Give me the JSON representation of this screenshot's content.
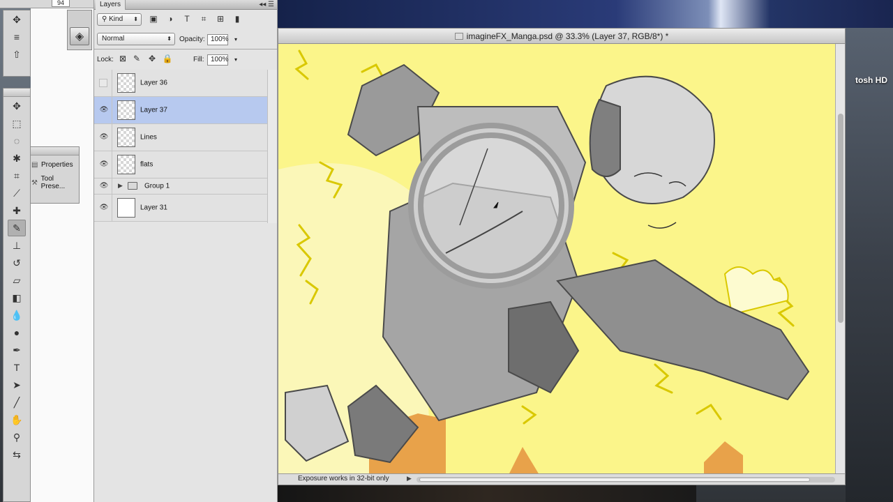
{
  "options_bar": {
    "size_value": "94"
  },
  "desktop": {
    "hd_label": "tosh HD"
  },
  "layers_panel": {
    "tab_label": "Layers",
    "filter_kind": "Kind",
    "blend_mode": "Normal",
    "opacity_label": "Opacity:",
    "opacity_value": "100%",
    "lock_label": "Lock:",
    "fill_label": "Fill:",
    "fill_value": "100%",
    "layers": [
      {
        "name": "Layer 36",
        "visible": false,
        "selected": false,
        "type": "layer"
      },
      {
        "name": "Layer 37",
        "visible": true,
        "selected": true,
        "type": "layer"
      },
      {
        "name": "Lines",
        "visible": true,
        "selected": false,
        "type": "layer"
      },
      {
        "name": "flats",
        "visible": true,
        "selected": false,
        "type": "layer"
      },
      {
        "name": "Group 1",
        "visible": true,
        "selected": false,
        "type": "group"
      },
      {
        "name": "Layer 31",
        "visible": true,
        "selected": false,
        "type": "layer-white"
      }
    ]
  },
  "float_panel": {
    "items": [
      {
        "label": "Properties",
        "icon": "properties-icon"
      },
      {
        "label": "Tool Prese...",
        "icon": "tool-presets-icon"
      }
    ]
  },
  "document": {
    "title": "imagineFX_Manga.psd @ 33.3% (Layer 37, RGB/8*) *",
    "status_text": "Exposure works in 32-bit only"
  },
  "colors": {
    "canvas_yellow": "#fbf58a",
    "layer_selected": "#b7c9ef",
    "sketch_gray": "#8a8a8a",
    "orange_buildings": "#e8a24a"
  }
}
